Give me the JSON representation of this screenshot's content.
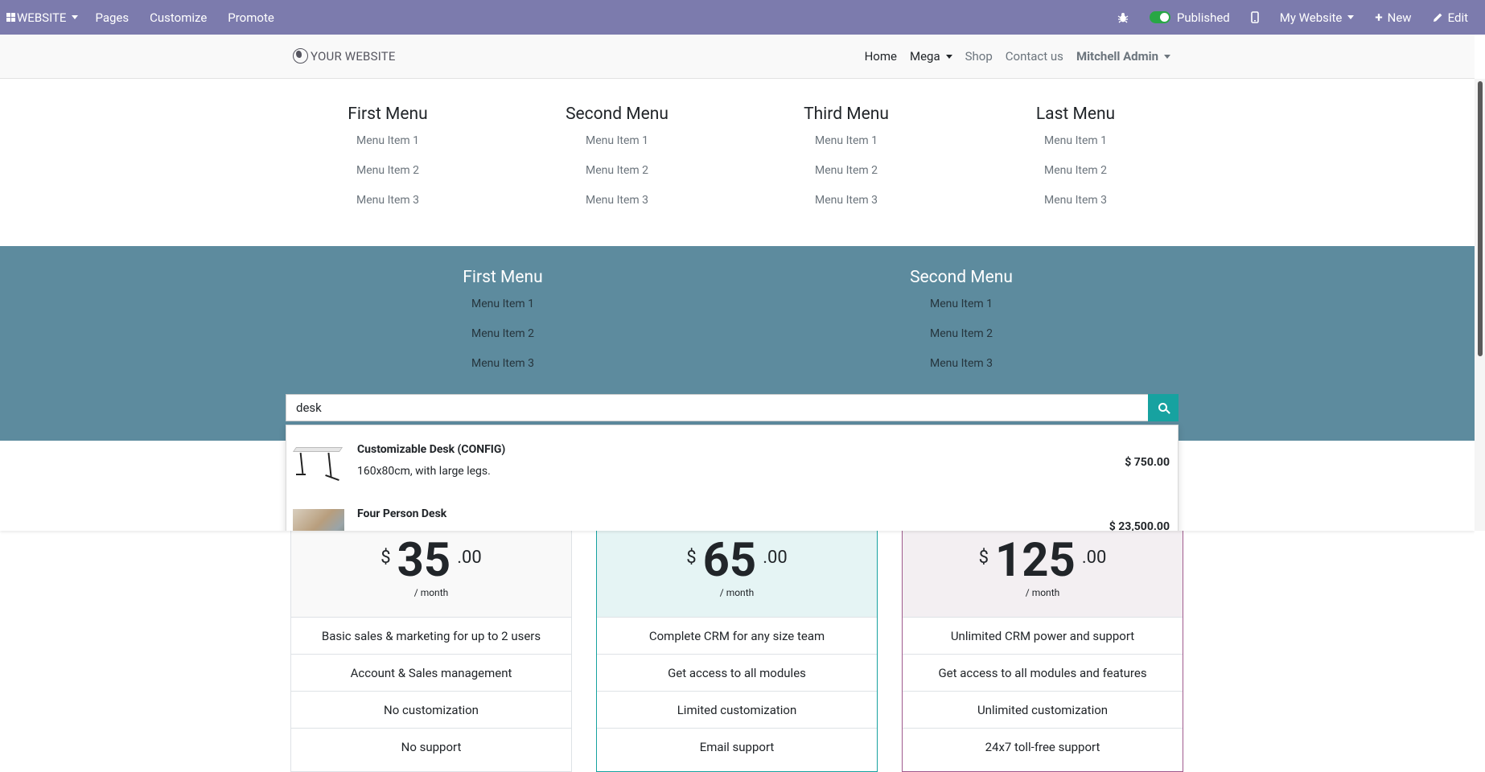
{
  "adminbar": {
    "app_label": "WEBSITE",
    "menu": [
      "Pages",
      "Customize",
      "Promote"
    ],
    "published_label": "Published",
    "website_label": "My Website",
    "new_label": "New",
    "edit_label": "Edit"
  },
  "header": {
    "logo": "YOUR WEBSITE",
    "nav": [
      "Home",
      "Mega",
      "Shop",
      "Contact us"
    ],
    "user": "Mitchell Admin"
  },
  "mega_top": [
    {
      "title": "First Menu",
      "items": [
        "Menu Item 1",
        "Menu Item 2",
        "Menu Item 3"
      ]
    },
    {
      "title": "Second Menu",
      "items": [
        "Menu Item 1",
        "Menu Item 2",
        "Menu Item 3"
      ]
    },
    {
      "title": "Third Menu",
      "items": [
        "Menu Item 1",
        "Menu Item 2",
        "Menu Item 3"
      ]
    },
    {
      "title": "Last Menu",
      "items": [
        "Menu Item 1",
        "Menu Item 2",
        "Menu Item 3"
      ]
    }
  ],
  "mega_band": [
    {
      "title": "First Menu",
      "items": [
        "Menu Item 1",
        "Menu Item 2",
        "Menu Item 3"
      ]
    },
    {
      "title": "Second Menu",
      "items": [
        "Menu Item 1",
        "Menu Item 2",
        "Menu Item 3"
      ]
    }
  ],
  "search": {
    "value": "desk"
  },
  "results": [
    {
      "name": "Customizable Desk (CONFIG)",
      "desc": "160x80cm, with large legs.",
      "price": "$ 750.00"
    },
    {
      "name": "Four Person Desk",
      "desc": "",
      "price": "$ 23,500.00"
    }
  ],
  "pricing": [
    {
      "currency": "$",
      "amount": "35",
      "cents": ".00",
      "period": "/ month",
      "bg": "#f9f9f9",
      "border": "#dee2e6",
      "features": [
        "Basic sales & marketing for up to 2 users",
        "Account & Sales management",
        "No customization",
        "No support"
      ]
    },
    {
      "currency": "$",
      "amount": "65",
      "cents": ".00",
      "period": "/ month",
      "bg": "#e5f4f4",
      "border": "#17a2a0",
      "features": [
        "Complete CRM for any size team",
        "Get access to all modules",
        "Limited customization",
        "Email support"
      ]
    },
    {
      "currency": "$",
      "amount": "125",
      "cents": ".00",
      "period": "/ month",
      "bg": "#f3eff2",
      "border": "#9f5a8d",
      "features": [
        "Unlimited CRM power and support",
        "Get access to all modules and features",
        "Unlimited customization",
        "24x7 toll-free support"
      ]
    }
  ],
  "colors": {
    "adminbar": "#7c7bad",
    "band": "#5d8b9e",
    "accent": "#17a2a0"
  }
}
